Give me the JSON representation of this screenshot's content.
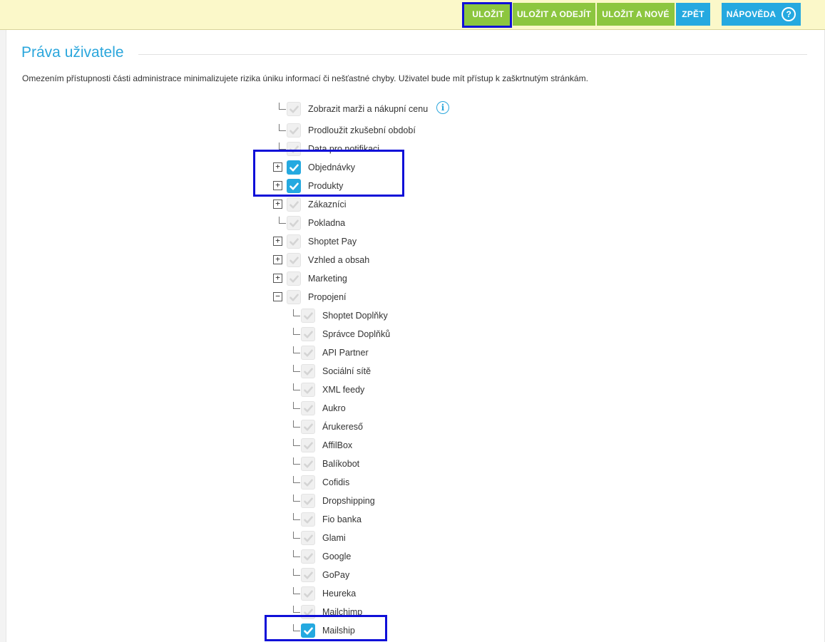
{
  "toolbar": {
    "save": "ULOŽIT",
    "save_and_exit": "ULOŽIT A ODEJÍT",
    "save_and_new": "ULOŽIT A NOVÉ",
    "back": "ZPĚT",
    "help": "NÁPOVĚDA",
    "help_icon": "?"
  },
  "page": {
    "title": "Práva uživatele",
    "intro": "Omezením přístupnosti části administrace minimalizujete rizika úniku informací či nešťastné chyby. Uživatel bude mít přístup k zaškrtnutým stránkám."
  },
  "tree": {
    "info_icon": "i",
    "items": [
      {
        "label": "Zobrazit marži a nákupní cenu",
        "checked": false,
        "level": 0,
        "toggle": "",
        "info": true
      },
      {
        "label": "Prodloužit zkušební období",
        "checked": false,
        "level": 0,
        "toggle": ""
      },
      {
        "label": "Data pro notifikaci",
        "checked": false,
        "level": 0,
        "toggle": ""
      },
      {
        "label": "Objednávky",
        "checked": true,
        "level": 0,
        "toggle": "+"
      },
      {
        "label": "Produkty",
        "checked": true,
        "level": 0,
        "toggle": "+"
      },
      {
        "label": "Zákazníci",
        "checked": false,
        "level": 0,
        "toggle": "+"
      },
      {
        "label": "Pokladna",
        "checked": false,
        "level": 0,
        "toggle": ""
      },
      {
        "label": "Shoptet Pay",
        "checked": false,
        "level": 0,
        "toggle": "+"
      },
      {
        "label": "Vzhled a obsah",
        "checked": false,
        "level": 0,
        "toggle": "+"
      },
      {
        "label": "Marketing",
        "checked": false,
        "level": 0,
        "toggle": "+"
      },
      {
        "label": "Propojení",
        "checked": false,
        "level": 0,
        "toggle": "−"
      },
      {
        "label": "Shoptet Doplňky",
        "checked": false,
        "level": 1,
        "toggle": ""
      },
      {
        "label": "Správce Doplňků",
        "checked": false,
        "level": 1,
        "toggle": ""
      },
      {
        "label": "API Partner",
        "checked": false,
        "level": 1,
        "toggle": ""
      },
      {
        "label": "Sociální sítě",
        "checked": false,
        "level": 1,
        "toggle": ""
      },
      {
        "label": "XML feedy",
        "checked": false,
        "level": 1,
        "toggle": ""
      },
      {
        "label": "Aukro",
        "checked": false,
        "level": 1,
        "toggle": ""
      },
      {
        "label": "Árukereső",
        "checked": false,
        "level": 1,
        "toggle": ""
      },
      {
        "label": "AffilBox",
        "checked": false,
        "level": 1,
        "toggle": ""
      },
      {
        "label": "Balíkobot",
        "checked": false,
        "level": 1,
        "toggle": ""
      },
      {
        "label": "Cofidis",
        "checked": false,
        "level": 1,
        "toggle": ""
      },
      {
        "label": "Dropshipping",
        "checked": false,
        "level": 1,
        "toggle": ""
      },
      {
        "label": "Fio banka",
        "checked": false,
        "level": 1,
        "toggle": ""
      },
      {
        "label": "Glami",
        "checked": false,
        "level": 1,
        "toggle": ""
      },
      {
        "label": "Google",
        "checked": false,
        "level": 1,
        "toggle": ""
      },
      {
        "label": "GoPay",
        "checked": false,
        "level": 1,
        "toggle": ""
      },
      {
        "label": "Heureka",
        "checked": false,
        "level": 1,
        "toggle": ""
      },
      {
        "label": "Mailchimp",
        "checked": false,
        "level": 1,
        "toggle": ""
      },
      {
        "label": "Mailship",
        "checked": true,
        "level": 1,
        "toggle": ""
      }
    ]
  },
  "colors": {
    "accent_blue": "#25a9e0",
    "accent_green": "#8cc63f",
    "highlight": "#0f0fd8"
  }
}
